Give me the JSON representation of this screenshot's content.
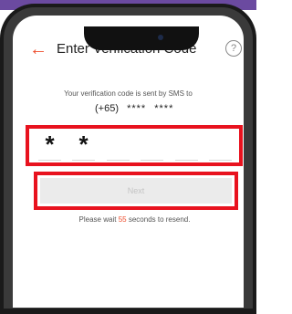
{
  "colors": {
    "accent": "#ee4d2d",
    "highlight_border": "#e8121e",
    "frame": "#1a1a1a"
  },
  "header": {
    "back_icon": "back-arrow-icon",
    "title": "Enter Verification Code",
    "help_icon": "help-circle-icon",
    "help_glyph": "?"
  },
  "info": {
    "sms_message": "Your verification code is sent by SMS to",
    "country_code": "(+65)",
    "masked_number_part1": "****",
    "masked_number_part2": "****"
  },
  "code": {
    "digits": [
      "*",
      "*",
      "",
      "",
      "",
      ""
    ]
  },
  "next_button": {
    "label": "Next",
    "enabled": false
  },
  "resend": {
    "prefix": "Please wait",
    "seconds": "55",
    "suffix": "seconds to resend."
  }
}
